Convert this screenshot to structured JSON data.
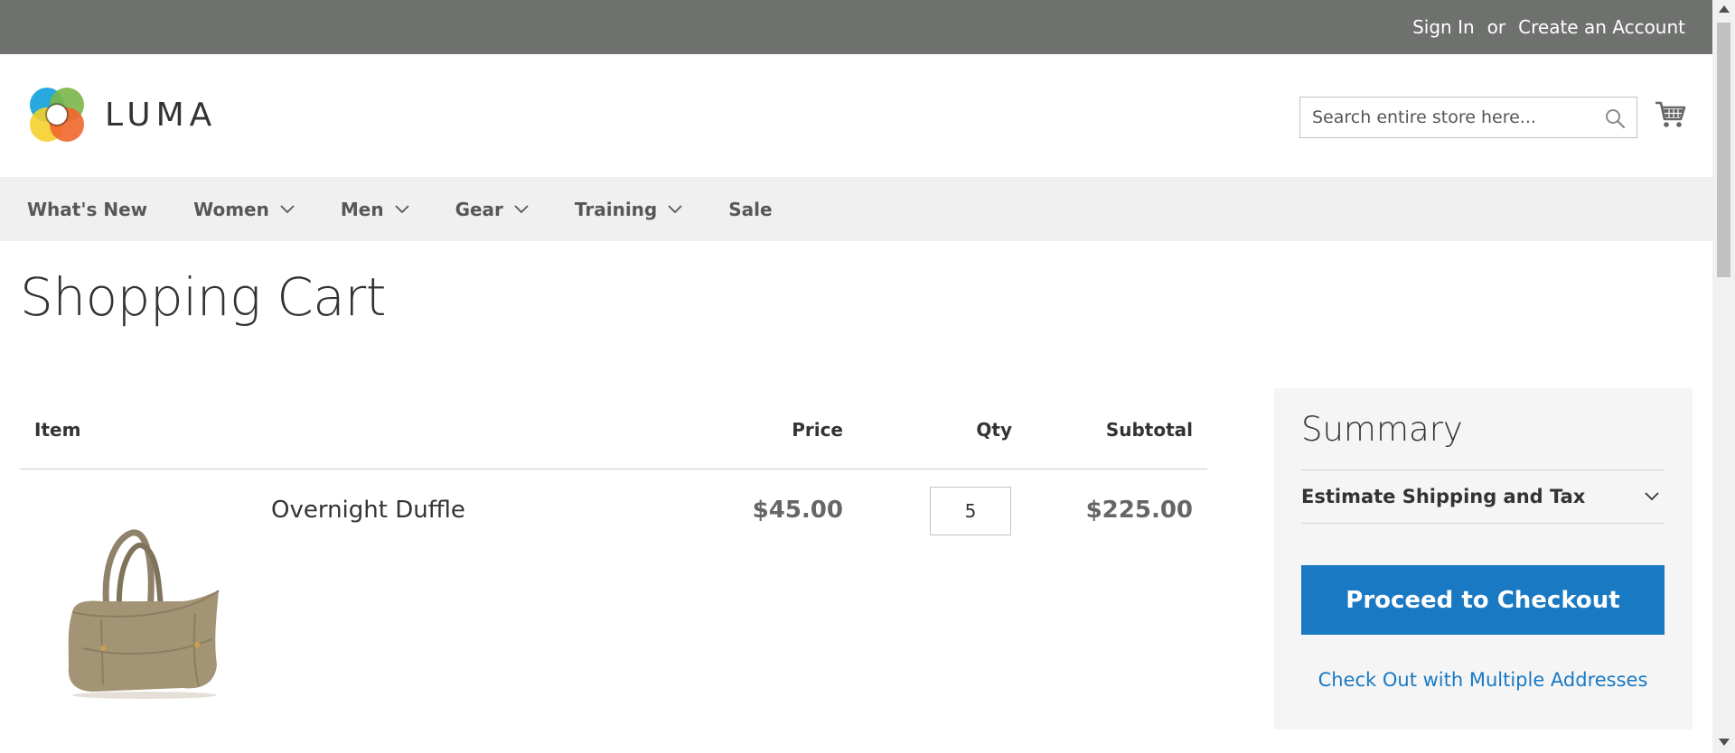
{
  "top_links": {
    "sign_in": "Sign In",
    "or": "or",
    "create_account": "Create an Account"
  },
  "header": {
    "logo_text": "LUMA",
    "search_placeholder": "Search entire store here...",
    "search_icon": "search-icon",
    "cart_icon": "cart-icon"
  },
  "nav": {
    "items": [
      {
        "label": "What's New",
        "has_dropdown": false
      },
      {
        "label": "Women",
        "has_dropdown": true
      },
      {
        "label": "Men",
        "has_dropdown": true
      },
      {
        "label": "Gear",
        "has_dropdown": true
      },
      {
        "label": "Training",
        "has_dropdown": true
      },
      {
        "label": "Sale",
        "has_dropdown": false
      }
    ]
  },
  "page": {
    "title": "Shopping Cart"
  },
  "cart": {
    "columns": {
      "item": "Item",
      "price": "Price",
      "qty": "Qty",
      "subtotal": "Subtotal"
    },
    "items": [
      {
        "name": "Overnight Duffle",
        "price": "$45.00",
        "qty": "5",
        "subtotal": "$225.00"
      }
    ]
  },
  "summary": {
    "title": "Summary",
    "estimate_label": "Estimate Shipping and Tax",
    "checkout_label": "Proceed to Checkout",
    "multi_address_label": "Check Out with Multiple Addresses"
  },
  "colors": {
    "top_bar": "#6e716e",
    "nav_bg": "#f0f0f0",
    "primary_button": "#1979c3",
    "link": "#1979c3",
    "summary_bg": "#f5f5f5"
  }
}
